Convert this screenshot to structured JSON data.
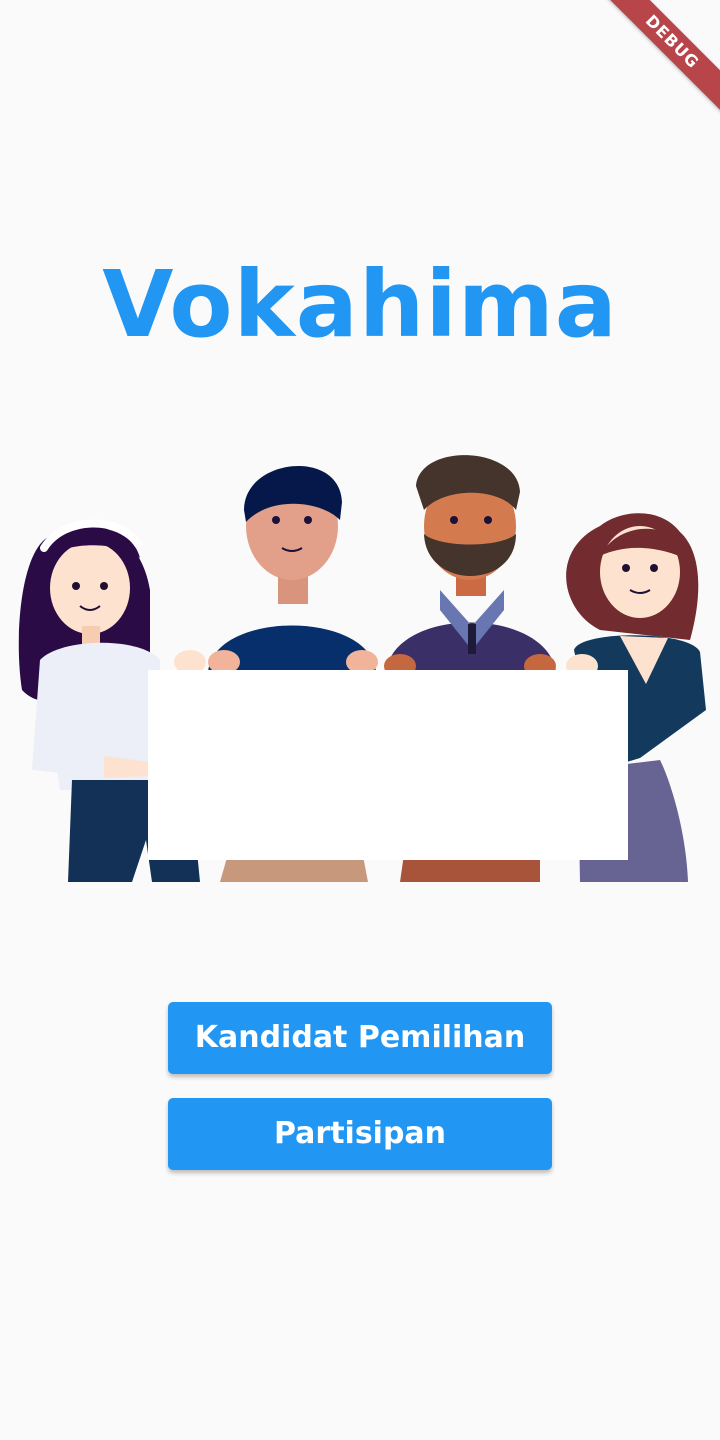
{
  "app": {
    "title": "Vokahima",
    "debug_banner": "DEBUG"
  },
  "buttons": {
    "candidates_label": "Kandidat Pemilihan",
    "participants_label": "Partisipan"
  },
  "illustration": {
    "subject": "four-people-holding-blank-sign"
  },
  "colors": {
    "background": "#fafafa",
    "accent": "#2196f3",
    "button_text": "#ffffff",
    "debug_banner": "#b8454a"
  }
}
